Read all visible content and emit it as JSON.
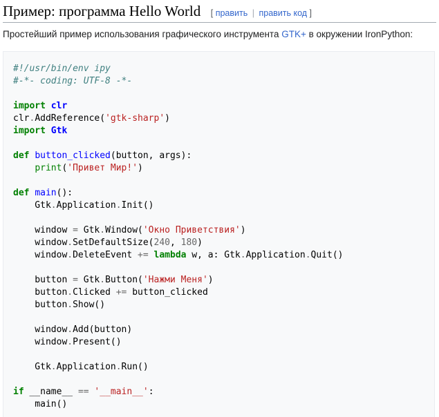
{
  "heading": {
    "title": "Пример: программа Hello World",
    "edit_open": "[",
    "edit_label": "править",
    "edit_sep": "|",
    "edit_code_label": "править код",
    "edit_close": "]"
  },
  "intro": {
    "before": "Простейший пример использования графического инструмента ",
    "link": "GTK+",
    "after": " в окружении IronPython:"
  },
  "code": {
    "lines": [
      [
        {
          "t": "#!/usr/bin/env ipy",
          "c": "comment"
        }
      ],
      [
        {
          "t": "#-*- coding: UTF-8 -*-",
          "c": "comment"
        }
      ],
      [],
      [
        {
          "t": "import",
          "c": "kw"
        },
        {
          "t": " "
        },
        {
          "t": "clr",
          "c": "ns"
        }
      ],
      [
        {
          "t": "clr"
        },
        {
          "t": ".",
          "c": "op"
        },
        {
          "t": "AddReference("
        },
        {
          "t": "'gtk-sharp'",
          "c": "str"
        },
        {
          "t": ")"
        }
      ],
      [
        {
          "t": "import",
          "c": "kw"
        },
        {
          "t": " "
        },
        {
          "t": "Gtk",
          "c": "ns"
        }
      ],
      [],
      [
        {
          "t": "def",
          "c": "kw"
        },
        {
          "t": " "
        },
        {
          "t": "button_clicked",
          "c": "fn"
        },
        {
          "t": "(button, args):"
        }
      ],
      [
        {
          "t": "    "
        },
        {
          "t": "print",
          "c": "bi"
        },
        {
          "t": "("
        },
        {
          "t": "'Привет Мир!'",
          "c": "str"
        },
        {
          "t": ")"
        }
      ],
      [],
      [
        {
          "t": "def",
          "c": "kw"
        },
        {
          "t": " "
        },
        {
          "t": "main",
          "c": "fn"
        },
        {
          "t": "():"
        }
      ],
      [
        {
          "t": "    Gtk"
        },
        {
          "t": ".",
          "c": "op"
        },
        {
          "t": "Application"
        },
        {
          "t": ".",
          "c": "op"
        },
        {
          "t": "Init()"
        }
      ],
      [],
      [
        {
          "t": "    window "
        },
        {
          "t": "=",
          "c": "op"
        },
        {
          "t": " Gtk"
        },
        {
          "t": ".",
          "c": "op"
        },
        {
          "t": "Window("
        },
        {
          "t": "'Окно Приветствия'",
          "c": "str"
        },
        {
          "t": ")"
        }
      ],
      [
        {
          "t": "    window"
        },
        {
          "t": ".",
          "c": "op"
        },
        {
          "t": "SetDefaultSize("
        },
        {
          "t": "240",
          "c": "op"
        },
        {
          "t": ", "
        },
        {
          "t": "180",
          "c": "op"
        },
        {
          "t": ")"
        }
      ],
      [
        {
          "t": "    window"
        },
        {
          "t": ".",
          "c": "op"
        },
        {
          "t": "DeleteEvent "
        },
        {
          "t": "+=",
          "c": "op"
        },
        {
          "t": " "
        },
        {
          "t": "lambda",
          "c": "kw"
        },
        {
          "t": " w, a: Gtk"
        },
        {
          "t": ".",
          "c": "op"
        },
        {
          "t": "Application"
        },
        {
          "t": ".",
          "c": "op"
        },
        {
          "t": "Quit()"
        }
      ],
      [],
      [
        {
          "t": "    button "
        },
        {
          "t": "=",
          "c": "op"
        },
        {
          "t": " Gtk"
        },
        {
          "t": ".",
          "c": "op"
        },
        {
          "t": "Button("
        },
        {
          "t": "'Нажми Меня'",
          "c": "str"
        },
        {
          "t": ")"
        }
      ],
      [
        {
          "t": "    button"
        },
        {
          "t": ".",
          "c": "op"
        },
        {
          "t": "Clicked "
        },
        {
          "t": "+=",
          "c": "op"
        },
        {
          "t": " button_clicked"
        }
      ],
      [
        {
          "t": "    button"
        },
        {
          "t": ".",
          "c": "op"
        },
        {
          "t": "Show()"
        }
      ],
      [],
      [
        {
          "t": "    window"
        },
        {
          "t": ".",
          "c": "op"
        },
        {
          "t": "Add(button)"
        }
      ],
      [
        {
          "t": "    window"
        },
        {
          "t": ".",
          "c": "op"
        },
        {
          "t": "Present()"
        }
      ],
      [],
      [
        {
          "t": "    Gtk"
        },
        {
          "t": ".",
          "c": "op"
        },
        {
          "t": "Application"
        },
        {
          "t": ".",
          "c": "op"
        },
        {
          "t": "Run()"
        }
      ],
      [],
      [
        {
          "t": "if",
          "c": "kw"
        },
        {
          "t": " __name__ "
        },
        {
          "t": "==",
          "c": "op"
        },
        {
          "t": " "
        },
        {
          "t": "'__main__'",
          "c": "str"
        },
        {
          "t": ":"
        }
      ],
      [
        {
          "t": "    main()"
        }
      ]
    ]
  }
}
